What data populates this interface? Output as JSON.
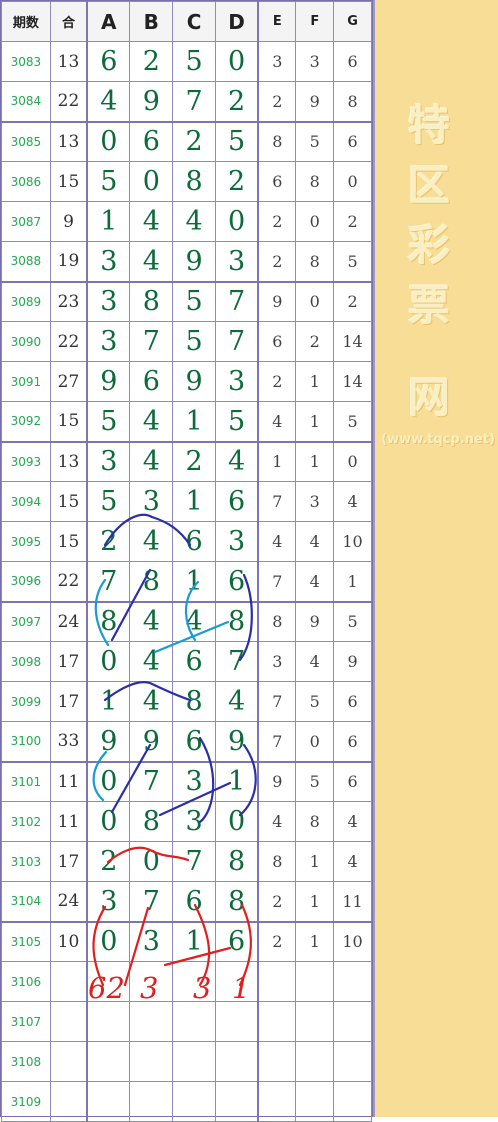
{
  "header": [
    "期数",
    "合",
    "A",
    "B",
    "C",
    "D",
    "E",
    "F",
    "G"
  ],
  "rows": [
    {
      "period": "3083",
      "sum": "13",
      "main": [
        "6",
        "2",
        "5",
        "0"
      ],
      "small": [
        "3",
        "3",
        "6"
      ]
    },
    {
      "period": "3084",
      "sum": "22",
      "main": [
        "4",
        "9",
        "7",
        "2"
      ],
      "small": [
        "2",
        "9",
        "8"
      ]
    },
    {
      "period": "3085",
      "sum": "13",
      "main": [
        "0",
        "6",
        "2",
        "5"
      ],
      "small": [
        "8",
        "5",
        "6"
      ]
    },
    {
      "period": "3086",
      "sum": "15",
      "main": [
        "5",
        "0",
        "8",
        "2"
      ],
      "small": [
        "6",
        "8",
        "0"
      ]
    },
    {
      "period": "3087",
      "sum": "9",
      "main": [
        "1",
        "4",
        "4",
        "0"
      ],
      "small": [
        "2",
        "0",
        "2"
      ]
    },
    {
      "period": "3088",
      "sum": "19",
      "main": [
        "3",
        "4",
        "9",
        "3"
      ],
      "small": [
        "2",
        "8",
        "5"
      ]
    },
    {
      "period": "3089",
      "sum": "23",
      "main": [
        "3",
        "8",
        "5",
        "7"
      ],
      "small": [
        "9",
        "0",
        "2"
      ]
    },
    {
      "period": "3090",
      "sum": "22",
      "main": [
        "3",
        "7",
        "5",
        "7"
      ],
      "small": [
        "6",
        "2",
        "14"
      ]
    },
    {
      "period": "3091",
      "sum": "27",
      "main": [
        "9",
        "6",
        "9",
        "3"
      ],
      "small": [
        "2",
        "1",
        "14"
      ]
    },
    {
      "period": "3092",
      "sum": "15",
      "main": [
        "5",
        "4",
        "1",
        "5"
      ],
      "small": [
        "4",
        "1",
        "5"
      ]
    },
    {
      "period": "3093",
      "sum": "13",
      "main": [
        "3",
        "4",
        "2",
        "4"
      ],
      "small": [
        "1",
        "1",
        "0"
      ]
    },
    {
      "period": "3094",
      "sum": "15",
      "main": [
        "5",
        "3",
        "1",
        "6"
      ],
      "small": [
        "7",
        "3",
        "4"
      ]
    },
    {
      "period": "3095",
      "sum": "15",
      "main": [
        "2",
        "4",
        "6",
        "3"
      ],
      "small": [
        "4",
        "4",
        "10"
      ]
    },
    {
      "period": "3096",
      "sum": "22",
      "main": [
        "7",
        "8",
        "1",
        "6"
      ],
      "small": [
        "7",
        "4",
        "1"
      ]
    },
    {
      "period": "3097",
      "sum": "24",
      "main": [
        "8",
        "4",
        "4",
        "8"
      ],
      "small": [
        "8",
        "9",
        "5"
      ]
    },
    {
      "period": "3098",
      "sum": "17",
      "main": [
        "0",
        "4",
        "6",
        "7"
      ],
      "small": [
        "3",
        "4",
        "9"
      ]
    },
    {
      "period": "3099",
      "sum": "17",
      "main": [
        "1",
        "4",
        "8",
        "4"
      ],
      "small": [
        "7",
        "5",
        "6"
      ]
    },
    {
      "period": "3100",
      "sum": "33",
      "main": [
        "9",
        "9",
        "6",
        "9"
      ],
      "small": [
        "7",
        "0",
        "6"
      ]
    },
    {
      "period": "3101",
      "sum": "11",
      "main": [
        "0",
        "7",
        "3",
        "1"
      ],
      "small": [
        "9",
        "5",
        "6"
      ]
    },
    {
      "period": "3102",
      "sum": "11",
      "main": [
        "0",
        "8",
        "3",
        "0"
      ],
      "small": [
        "4",
        "8",
        "4"
      ]
    },
    {
      "period": "3103",
      "sum": "17",
      "main": [
        "2",
        "0",
        "7",
        "8"
      ],
      "small": [
        "8",
        "1",
        "4"
      ]
    },
    {
      "period": "3104",
      "sum": "24",
      "main": [
        "3",
        "7",
        "6",
        "8"
      ],
      "small": [
        "2",
        "1",
        "11"
      ]
    },
    {
      "period": "3105",
      "sum": "10",
      "main": [
        "0",
        "3",
        "1",
        "6"
      ],
      "small": [
        "2",
        "1",
        "10"
      ]
    },
    {
      "period": "3106",
      "sum": "",
      "main": [
        "",
        "",
        "",
        ""
      ],
      "small": [
        "",
        "",
        ""
      ]
    },
    {
      "period": "3107",
      "sum": "",
      "main": [
        "",
        "",
        "",
        ""
      ],
      "small": [
        "",
        "",
        ""
      ]
    },
    {
      "period": "3108",
      "sum": "",
      "main": [
        "",
        "",
        "",
        ""
      ],
      "small": [
        "",
        "",
        ""
      ]
    },
    {
      "period": "3109",
      "sum": "",
      "main": [
        "",
        "",
        "",
        ""
      ],
      "small": [
        "",
        "",
        ""
      ]
    }
  ],
  "handwritten": [
    "62",
    "3",
    "3",
    "1"
  ],
  "side": {
    "logo_chars": [
      "特",
      "区",
      "彩",
      "票",
      "网"
    ],
    "url": "(www.tqcp.net)"
  },
  "colors": {
    "period_text": "#23a84e",
    "main_text": "#0d6a3a",
    "grid_line": "#8f8bb8",
    "side_bg": "#f8dd96",
    "line_blue": "#2b2fa8",
    "line_cyan": "#1a9ad6",
    "line_red": "#e02020"
  }
}
